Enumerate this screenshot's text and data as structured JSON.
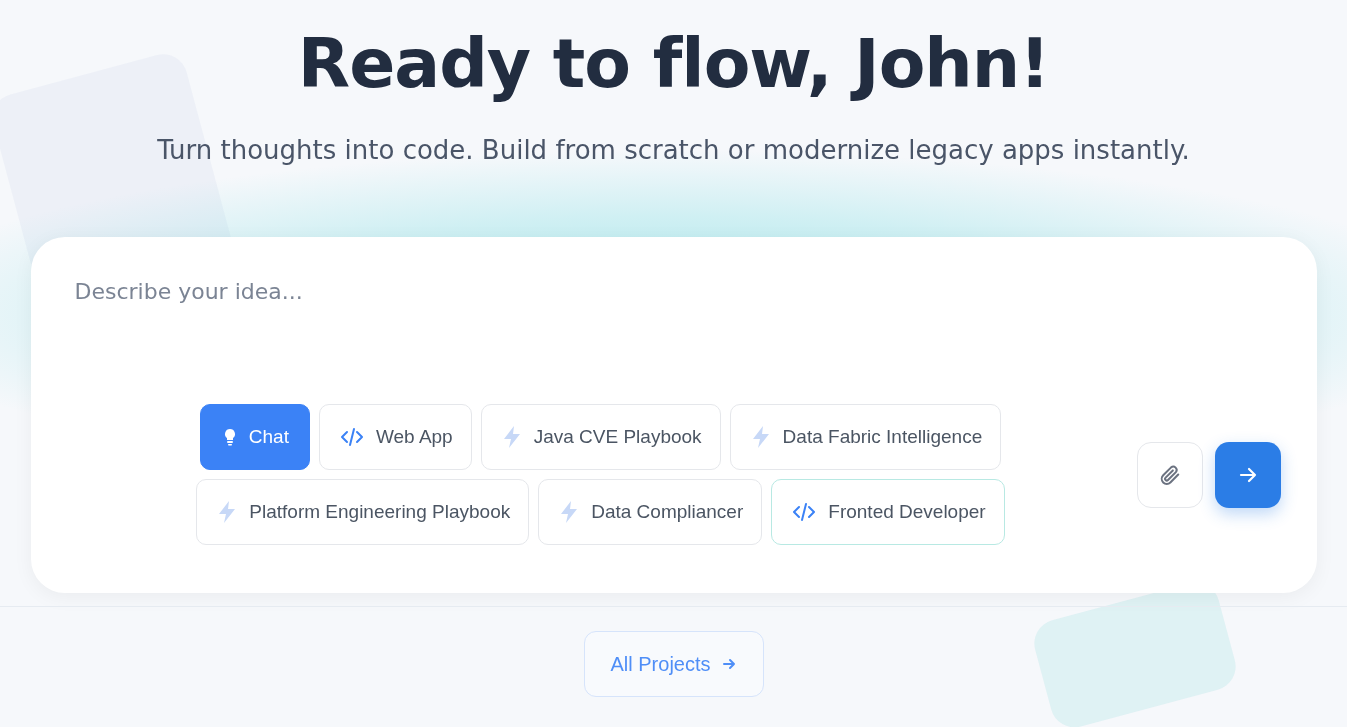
{
  "heading": "Ready to flow, John!",
  "subheading": "Turn thoughts into code. Build from scratch or modernize legacy apps instantly.",
  "prompt": {
    "placeholder": "Describe your idea..."
  },
  "modes": [
    {
      "label": "Chat",
      "kind": "bulb",
      "selected": true,
      "focused": false
    },
    {
      "label": "Web App",
      "kind": "code",
      "selected": false,
      "focused": false
    },
    {
      "label": "Java CVE Playbook",
      "kind": "bolt",
      "selected": false,
      "focused": false
    },
    {
      "label": "Data Fabric Intelligence",
      "kind": "bolt",
      "selected": false,
      "focused": false
    },
    {
      "label": "Platform Engineering Playbook",
      "kind": "bolt",
      "selected": false,
      "focused": false
    },
    {
      "label": "Data Compliancer",
      "kind": "bolt",
      "selected": false,
      "focused": false
    },
    {
      "label": "Fronted Developer",
      "kind": "code",
      "selected": false,
      "focused": true
    }
  ],
  "footer_link": {
    "label": "All Projects"
  }
}
